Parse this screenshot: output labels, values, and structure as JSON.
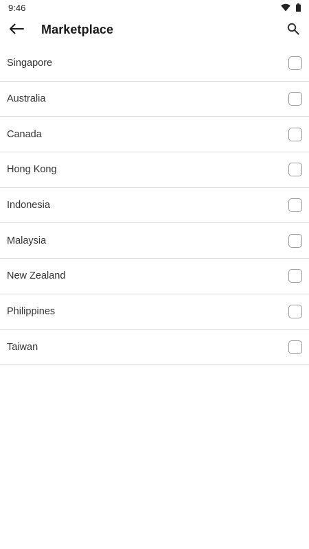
{
  "status_bar": {
    "time": "9:46",
    "icons": [
      "wifi-icon",
      "battery-icon"
    ]
  },
  "app_bar": {
    "title": "Marketplace",
    "back_icon": "arrow-left-icon",
    "search_icon": "search-icon"
  },
  "countries": [
    {
      "label": "Singapore",
      "checked": false
    },
    {
      "label": "Australia",
      "checked": false
    },
    {
      "label": "Canada",
      "checked": false
    },
    {
      "label": "Hong Kong",
      "checked": false
    },
    {
      "label": "Indonesia",
      "checked": false
    },
    {
      "label": "Malaysia",
      "checked": false
    },
    {
      "label": "New Zealand",
      "checked": false
    },
    {
      "label": "Philippines",
      "checked": false
    },
    {
      "label": "Taiwan",
      "checked": false
    }
  ],
  "colors": {
    "background": "#ffffff",
    "text": "#333333",
    "divider": "#dcdcdc",
    "checkbox_border": "#9a9a9a"
  }
}
